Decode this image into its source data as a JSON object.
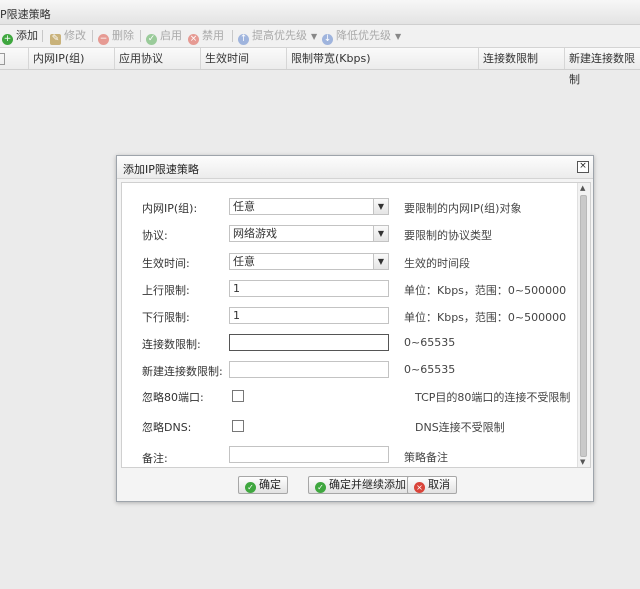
{
  "window": {
    "title": "P限速策略"
  },
  "toolbar": {
    "add": "添加",
    "edit": "修改",
    "delete": "删除",
    "enable": "启用",
    "disable": "禁用",
    "raise_priority": "提高优先级",
    "lower_priority": "降低优先级"
  },
  "table": {
    "columns": [
      "内网IP(组)",
      "应用协议",
      "生效时间",
      "限制带宽(Kbps)",
      "连接数限制",
      "新建连接数限制"
    ]
  },
  "dialog": {
    "title": "添加IP限速策略",
    "close": "×",
    "fields": {
      "ip": {
        "label": "内网IP(组):",
        "value": "任意",
        "hint": "要限制的内网IP(组)对象"
      },
      "protocol": {
        "label": "协议:",
        "value": "网络游戏",
        "hint": "要限制的协议类型"
      },
      "time": {
        "label": "生效时间:",
        "value": "任意",
        "hint": "生效的时间段"
      },
      "up": {
        "label": "上行限制:",
        "value": "1",
        "hint": "单位：Kbps，范围：0~500000"
      },
      "down": {
        "label": "下行限制:",
        "value": "1",
        "hint": "单位：Kbps，范围：0~500000"
      },
      "conn": {
        "label": "连接数限制:",
        "value": "",
        "hint": "0~65535"
      },
      "newconn": {
        "label": "新建连接数限制:",
        "value": "",
        "hint": "0~65535"
      },
      "ignore80": {
        "label": "忽略80端口:",
        "checked": false,
        "hint": "TCP目的80端口的连接不受限制"
      },
      "ignoredns": {
        "label": "忽略DNS:",
        "checked": false,
        "hint": "DNS连接不受限制"
      },
      "note": {
        "label": "备注:",
        "value": "",
        "hint": "策略备注"
      }
    },
    "buttons": {
      "ok": "确定",
      "ok_continue": "确定并继续添加",
      "cancel": "取消"
    }
  },
  "colors": {
    "green": "#3fa73f",
    "red": "#d9443a",
    "blue": "#6f8fc9",
    "gray": "#b5b5b5"
  }
}
